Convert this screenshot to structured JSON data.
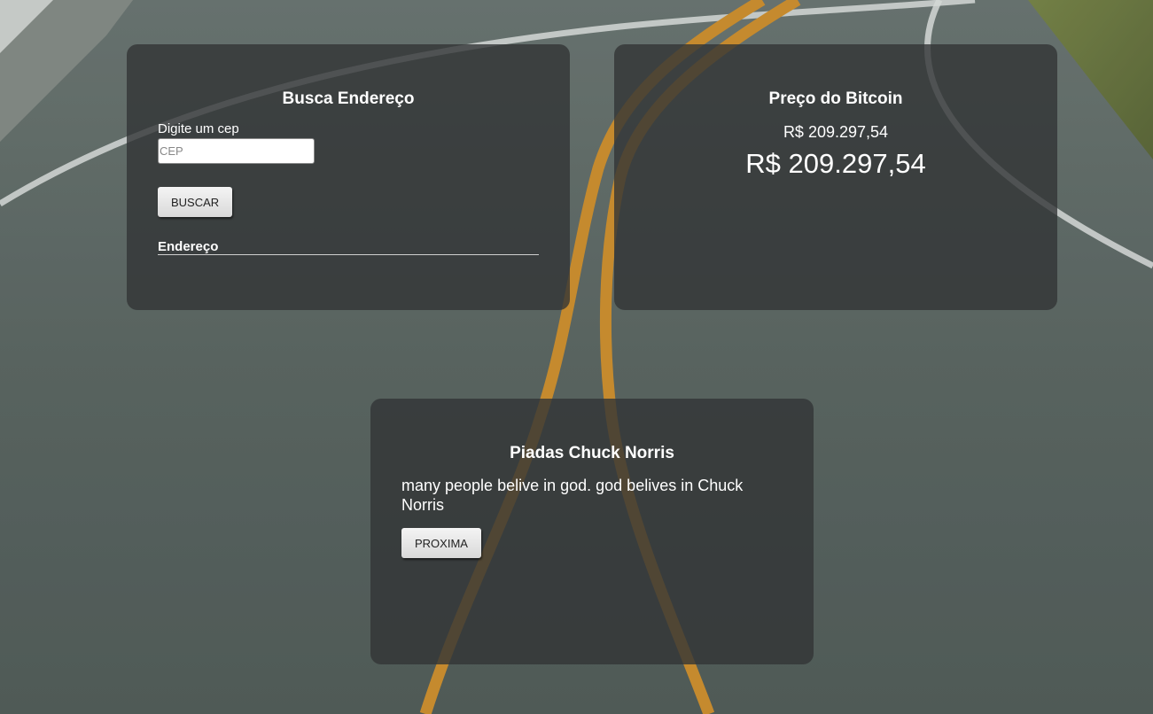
{
  "address_card": {
    "title": "Busca Endereço",
    "cep_label": "Digite um cep",
    "cep_placeholder": "CEP",
    "cep_value": "",
    "search_button": "BUSCAR",
    "result_heading": "Endereço"
  },
  "bitcoin_card": {
    "title": "Preço do Bitcoin",
    "price_small": "R$ 209.297,54",
    "price_large": "R$ 209.297,54"
  },
  "joke_card": {
    "title": "Piadas Chuck Norris",
    "joke": "many people belive in god. god belives in Chuck Norris",
    "next_button": "PROXIMA"
  },
  "colors": {
    "card_background": "#323436",
    "text": "#ffffff",
    "road_lines": "#d9962f"
  }
}
